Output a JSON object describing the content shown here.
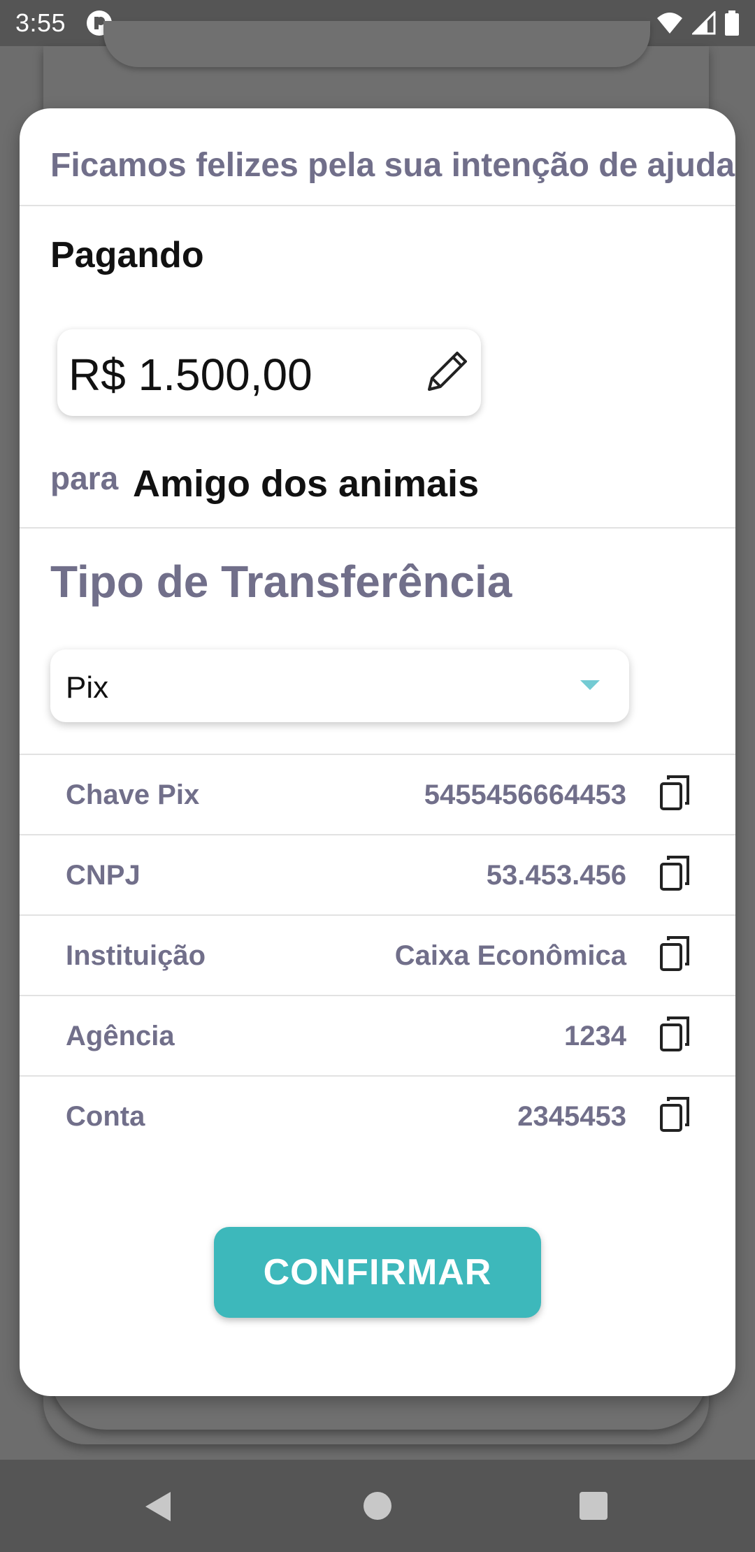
{
  "status_bar": {
    "time": "3:55",
    "icons": [
      "app-notification-icon",
      "wifi-icon",
      "signal-icon",
      "battery-icon"
    ]
  },
  "dialog": {
    "title": "Ficamos felizes pela sua intenção de ajudar",
    "paying_label": "Pagando",
    "amount": "R$ 1.500,00",
    "para_label": "para",
    "recipient": "Amigo dos animais",
    "transfer_title": "Tipo de Transferência",
    "transfer_select": {
      "value": "Pix"
    },
    "details": [
      {
        "label": "Chave Pix",
        "value": "5455456664453"
      },
      {
        "label": "CNPJ",
        "value": "53.453.456"
      },
      {
        "label": "Instituição",
        "value": "Caixa Econômica"
      },
      {
        "label": "Agência",
        "value": "1234"
      },
      {
        "label": "Conta",
        "value": "2345453"
      }
    ],
    "confirm_label": "CONFIRMAR"
  },
  "colors": {
    "accent": "#3db8bb",
    "muted_text": "#716f8a",
    "caret": "#74cbd3"
  },
  "nav_bar": {
    "icons": [
      "back-icon",
      "home-icon",
      "recents-icon"
    ]
  }
}
